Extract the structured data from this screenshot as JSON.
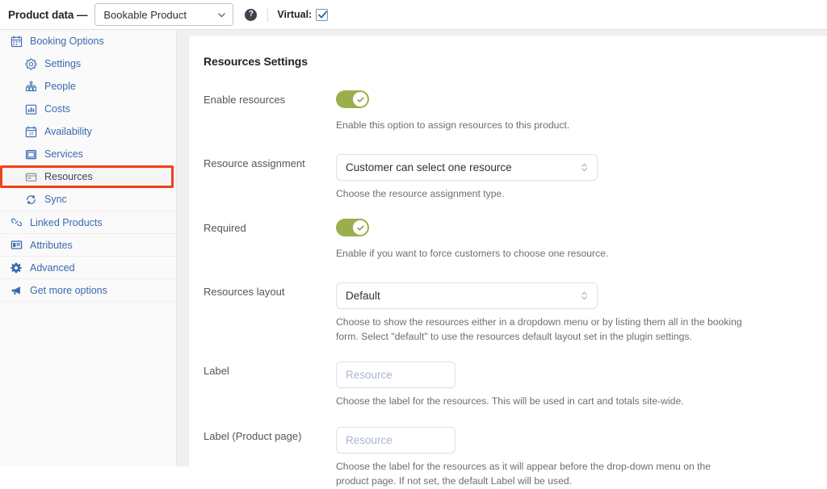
{
  "header": {
    "title": "Product data —",
    "product_type": "Bookable Product",
    "help_glyph": "?",
    "virtual_label": "Virtual:",
    "virtual_checked": true
  },
  "sidebar": {
    "items": [
      {
        "label": "Booking Options",
        "icon": "calendar-icon",
        "level": "top",
        "active": false
      },
      {
        "label": "Settings",
        "icon": "gear-icon",
        "level": "sub",
        "active": false
      },
      {
        "label": "People",
        "icon": "people-icon",
        "level": "sub",
        "active": false
      },
      {
        "label": "Costs",
        "icon": "bar-chart-icon",
        "level": "sub",
        "active": false
      },
      {
        "label": "Availability",
        "icon": "calendar-day-icon",
        "level": "sub",
        "active": false
      },
      {
        "label": "Services",
        "icon": "window-icon",
        "level": "sub",
        "active": false
      },
      {
        "label": "Resources",
        "icon": "resource-card-icon",
        "level": "sub",
        "active": true
      },
      {
        "label": "Sync",
        "icon": "sync-icon",
        "level": "sub",
        "active": false
      },
      {
        "label": "Linked Products",
        "icon": "link-icon",
        "level": "top",
        "active": false
      },
      {
        "label": "Attributes",
        "icon": "attributes-icon",
        "level": "top",
        "active": false
      },
      {
        "label": "Advanced",
        "icon": "gear-solid-icon",
        "level": "top",
        "active": false
      },
      {
        "label": "Get more options",
        "icon": "megaphone-icon",
        "level": "top",
        "active": false
      }
    ]
  },
  "panel": {
    "title": "Resources Settings",
    "fields": {
      "enable_resources": {
        "label": "Enable resources",
        "value": true,
        "description": "Enable this option to assign resources to this product."
      },
      "resource_assignment": {
        "label": "Resource assignment",
        "value": "Customer can select one resource",
        "description": "Choose the resource assignment type."
      },
      "required": {
        "label": "Required",
        "value": true,
        "description": "Enable if you want to force customers to choose one resource."
      },
      "resources_layout": {
        "label": "Resources layout",
        "value": "Default",
        "description": "Choose to show the resources either in a dropdown menu or by listing them all in the booking form. Select \"default\" to use the resources default layout set in the plugin settings."
      },
      "label": {
        "label": "Label",
        "value": "",
        "placeholder": "Resource",
        "description": "Choose the label for the resources. This will be used in cart and totals site-wide."
      },
      "label_product_page": {
        "label": "Label (Product page)",
        "value": "",
        "placeholder": "Resource",
        "description": "Choose the label for the resources as it will appear before the drop-down menu on the product page. If not set, the default Label will be used."
      }
    }
  },
  "colors": {
    "link": "#3a68b0",
    "toggle_on": "#9aae4d",
    "highlight": "#f2401b",
    "accent_check": "#2271b1"
  }
}
